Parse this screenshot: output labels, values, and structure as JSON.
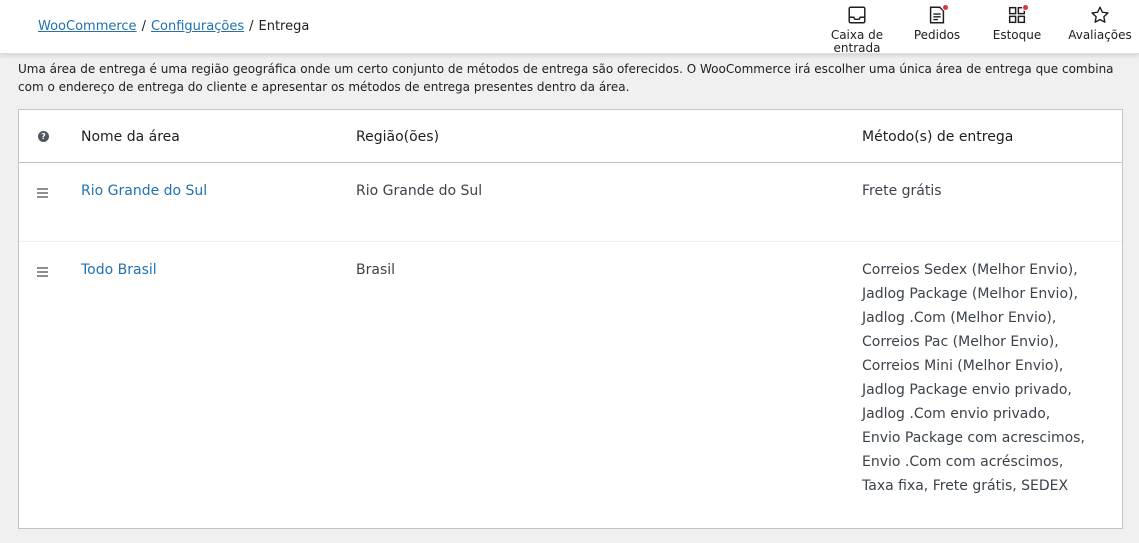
{
  "breadcrumb": {
    "items": [
      "WooCommerce",
      "Configurações",
      "Entrega"
    ]
  },
  "activity_bar": {
    "inbox": "Caixa de entrada",
    "orders": "Pedidos",
    "stock": "Estoque",
    "reviews": "Avaliações"
  },
  "description": "Uma área de entrega é uma região geográfica onde um certo conjunto de métodos de entrega são oferecidos. O WooCommerce irá escolher uma única área de entrega que combina com o endereço de entrega do cliente e apresentar os métodos de entrega presentes dentro da área.",
  "table": {
    "headers": {
      "help": "?",
      "zone_name": "Nome da área",
      "regions": "Região(ões)",
      "methods": "Método(s) de entrega"
    },
    "rows": [
      {
        "name": "Rio Grande do Sul",
        "region": "Rio Grande do Sul",
        "methods": "Frete grátis"
      },
      {
        "name": "Todo Brasil",
        "region": "Brasil",
        "methods": "Correios Sedex (Melhor Envio), Jadlog Package (Melhor Envio), Jadlog .Com (Melhor Envio), Correios Pac (Melhor Envio), Correios Mini (Melhor Envio), Jadlog Package envio privado, Jadlog .Com envio privado, Envio Package com acrescimos, Envio .Com com acréscimos, Taxa fixa, Frete grátis, SEDEX"
      }
    ]
  },
  "colors": {
    "link": "#2271b1",
    "notification_dot": "#d63638",
    "background": "#f0f0f1"
  }
}
